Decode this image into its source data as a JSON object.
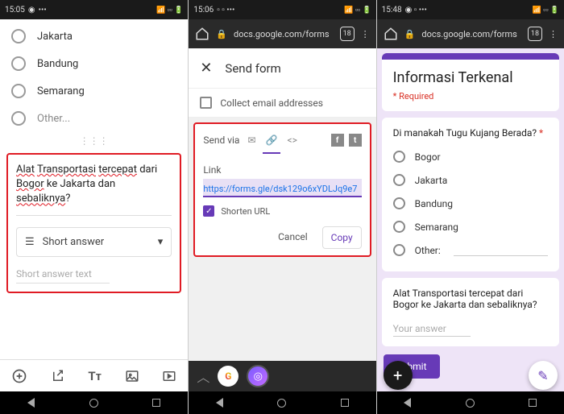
{
  "panel1": {
    "status": {
      "time": "15:05"
    },
    "radios": [
      "Jakarta",
      "Bandung",
      "Semarang",
      "Other..."
    ],
    "question": {
      "w1": "Alat",
      "w2": "Transportasi",
      "w3": "tercepat",
      "plain1": " dari ",
      "w4": "Bogor",
      "plain2": " ke Jakarta dan ",
      "w5": "sebaliknya",
      "plain3": "?"
    },
    "type_label": "Short answer",
    "placeholder": "Short answer text"
  },
  "panel2": {
    "status": {
      "time": "15:06"
    },
    "url": "docs.google.com/forms",
    "tab_count": "18",
    "send_header": "Send form",
    "collect": "Collect email addresses",
    "send_via": "Send via",
    "link_label": "Link",
    "link_value": "https://forms.gle/dsk129o6xYDLJq9e7",
    "shorten": "Shorten URL",
    "cancel": "Cancel",
    "copy": "Copy"
  },
  "panel3": {
    "status": {
      "time": "15:48"
    },
    "url": "docs.google.com/forms",
    "tab_count": "18",
    "title": "Informasi Terkenal",
    "required": "* Required",
    "q1": "Di manakah Tugu Kujang Berada?",
    "options": [
      "Bogor",
      "Jakarta",
      "Bandung",
      "Semarang",
      "Other:"
    ],
    "q2": "Alat Transportasi tercepat dari Bogor ke Jakarta dan sebaliknya?",
    "your_answer": "Your answer",
    "submit": "Submit"
  }
}
